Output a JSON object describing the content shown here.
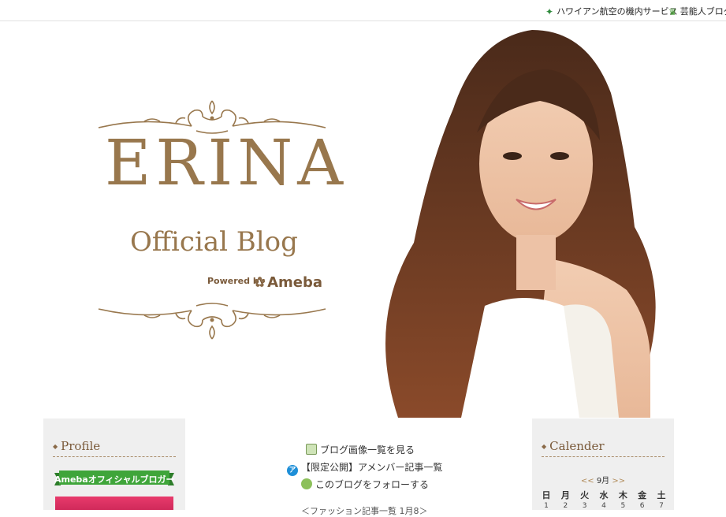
{
  "topbar": {
    "links": [
      {
        "label": "ハワイアン航空の機内サービス",
        "icon": "star-icon"
      },
      {
        "label": "芸能人ブログ",
        "icon": "crown-icon"
      }
    ]
  },
  "header": {
    "title": "ERINA",
    "subtitle": "Official Blog",
    "powered_by": "Powered by",
    "brand": "Ameba"
  },
  "sidebar_left": {
    "heading": "Profile",
    "ribbon": "Amebaオフィシャルブロガー"
  },
  "center": {
    "links": [
      {
        "label": "ブログ画像一覧を見る",
        "icon": "image-list-icon"
      },
      {
        "label": "【限定公開】アメンバー記事一覧",
        "icon": "amember-icon"
      },
      {
        "label": "このブログをフォローする",
        "icon": "follow-icon"
      }
    ],
    "partial": "＜ファッション記事一覧 1月8＞"
  },
  "sidebar_right": {
    "heading": "Calender",
    "prev": "<<",
    "month": "9月",
    "next": ">>",
    "weekdays": [
      "日",
      "月",
      "火",
      "水",
      "木",
      "金",
      "土"
    ],
    "days": [
      "1",
      "2",
      "3",
      "4",
      "5",
      "6",
      "7"
    ]
  },
  "colors": {
    "brand_gold": "#98774d",
    "sidebar_bg": "#efefef",
    "ribbon_green": "#3fa53a"
  }
}
